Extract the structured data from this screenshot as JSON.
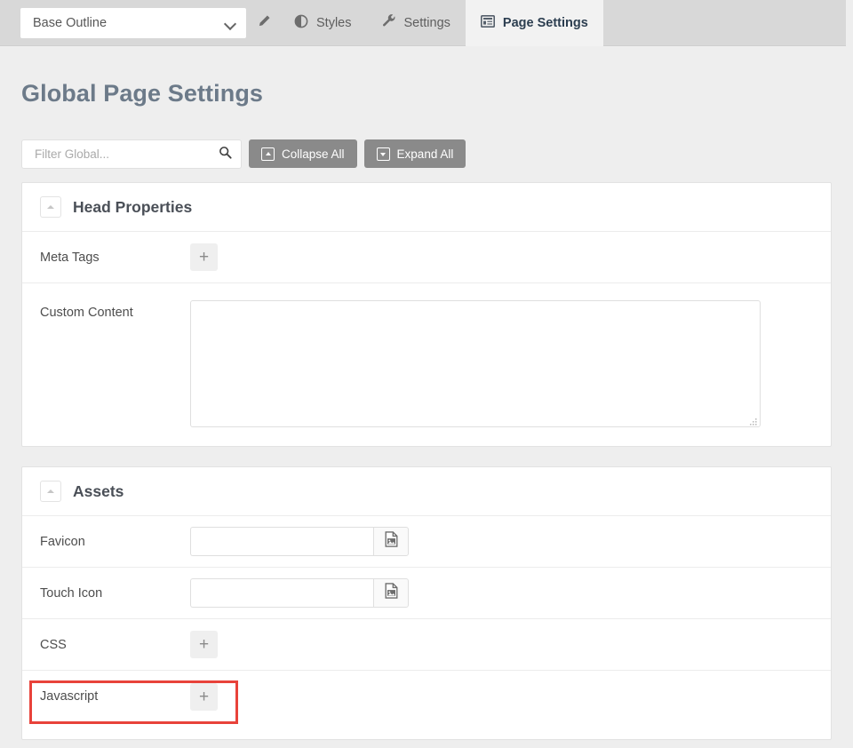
{
  "topbar": {
    "outline_select": {
      "value": "Base Outline",
      "icon": "chevron-down-icon"
    },
    "edit_button_icon": "pencil-icon",
    "tabs": [
      {
        "label": "Styles",
        "icon": "contrast-circle-icon",
        "active": false
      },
      {
        "label": "Settings",
        "icon": "wrench-icon",
        "active": false
      },
      {
        "label": "Page Settings",
        "icon": "list-panel-icon",
        "active": true
      }
    ]
  },
  "page": {
    "title": "Global Page Settings"
  },
  "toolbar": {
    "filter_placeholder": "Filter Global...",
    "filter_value": "",
    "search_icon": "search-icon",
    "collapse_all_label": "Collapse All",
    "collapse_all_icon": "boxed-caret-up-icon",
    "expand_all_label": "Expand All",
    "expand_all_icon": "boxed-caret-down-icon"
  },
  "panels": [
    {
      "title": "Head Properties",
      "toggle_icon": "caret-up-icon",
      "rows": [
        {
          "label": "Meta Tags",
          "control": "add-button",
          "add_label": "+"
        },
        {
          "label": "Custom Content",
          "control": "textarea",
          "value": "",
          "placeholder": ""
        }
      ]
    },
    {
      "title": "Assets",
      "toggle_icon": "caret-up-icon",
      "rows": [
        {
          "label": "Favicon",
          "control": "input-with-picker",
          "value": "",
          "picker_icon": "image-file-icon"
        },
        {
          "label": "Touch Icon",
          "control": "input-with-picker",
          "value": "",
          "picker_icon": "image-file-icon"
        },
        {
          "label": "CSS",
          "control": "add-button",
          "add_label": "+"
        },
        {
          "label": "Javascript",
          "control": "add-button",
          "add_label": "+",
          "highlighted": true
        }
      ]
    }
  ],
  "annotation": {
    "color": "#e8423a",
    "target": "Javascript"
  }
}
